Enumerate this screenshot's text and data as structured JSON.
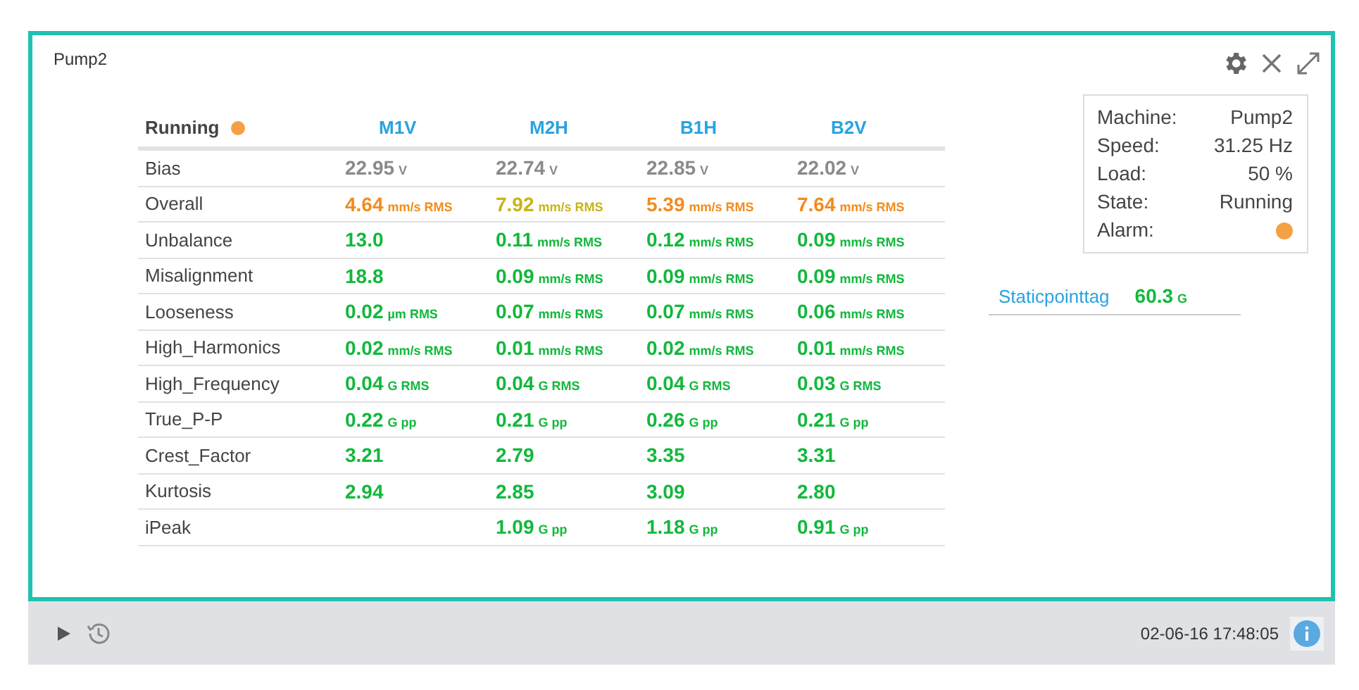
{
  "panel": {
    "title": "Pump2"
  },
  "table": {
    "state": {
      "label": "Running",
      "color": "#f5a045"
    },
    "columns": [
      "M1V",
      "M2H",
      "B1H",
      "B2V"
    ],
    "rows": [
      {
        "label": "Bias",
        "cells": [
          {
            "value": "22.95",
            "unit": "V",
            "color": "#8a8a8a"
          },
          {
            "value": "22.74",
            "unit": "V",
            "color": "#8a8a8a"
          },
          {
            "value": "22.85",
            "unit": "V",
            "color": "#8a8a8a"
          },
          {
            "value": "22.02",
            "unit": "V",
            "color": "#8a8a8a"
          }
        ]
      },
      {
        "label": "Overall",
        "cells": [
          {
            "value": "4.64",
            "unit": "mm/s RMS",
            "color": "#f28c1e"
          },
          {
            "value": "7.92",
            "unit": "mm/s RMS",
            "color": "#c9b418"
          },
          {
            "value": "5.39",
            "unit": "mm/s RMS",
            "color": "#f28c1e"
          },
          {
            "value": "7.64",
            "unit": "mm/s RMS",
            "color": "#f28c1e"
          }
        ]
      },
      {
        "label": "Unbalance",
        "cells": [
          {
            "value": "13.0",
            "color": "#12b83c"
          },
          {
            "value": "0.11",
            "unit": "mm/s RMS",
            "color": "#12b83c"
          },
          {
            "value": "0.12",
            "unit": "mm/s RMS",
            "color": "#12b83c"
          },
          {
            "value": "0.09",
            "unit": "mm/s RMS",
            "color": "#12b83c"
          }
        ]
      },
      {
        "label": "Misalignment",
        "cells": [
          {
            "value": "18.8",
            "color": "#12b83c"
          },
          {
            "value": "0.09",
            "unit": "mm/s RMS",
            "color": "#12b83c"
          },
          {
            "value": "0.09",
            "unit": "mm/s RMS",
            "color": "#12b83c"
          },
          {
            "value": "0.09",
            "unit": "mm/s RMS",
            "color": "#12b83c"
          }
        ]
      },
      {
        "label": "Looseness",
        "cells": [
          {
            "value": "0.02",
            "unit": "µm RMS",
            "color": "#12b83c"
          },
          {
            "value": "0.07",
            "unit": "mm/s RMS",
            "color": "#12b83c"
          },
          {
            "value": "0.07",
            "unit": "mm/s RMS",
            "color": "#12b83c"
          },
          {
            "value": "0.06",
            "unit": "mm/s RMS",
            "color": "#12b83c"
          }
        ]
      },
      {
        "label": "High_Harmonics",
        "cells": [
          {
            "value": "0.02",
            "unit": "mm/s RMS",
            "color": "#12b83c"
          },
          {
            "value": "0.01",
            "unit": "mm/s RMS",
            "color": "#12b83c"
          },
          {
            "value": "0.02",
            "unit": "mm/s RMS",
            "color": "#12b83c"
          },
          {
            "value": "0.01",
            "unit": "mm/s RMS",
            "color": "#12b83c"
          }
        ]
      },
      {
        "label": "High_Frequency",
        "cells": [
          {
            "value": "0.04",
            "unit": "G RMS",
            "color": "#12b83c"
          },
          {
            "value": "0.04",
            "unit": "G RMS",
            "color": "#12b83c"
          },
          {
            "value": "0.04",
            "unit": "G RMS",
            "color": "#12b83c"
          },
          {
            "value": "0.03",
            "unit": "G RMS",
            "color": "#12b83c"
          }
        ]
      },
      {
        "label": "True_P-P",
        "cells": [
          {
            "value": "0.22",
            "unit": "G pp",
            "color": "#12b83c"
          },
          {
            "value": "0.21",
            "unit": "G pp",
            "color": "#12b83c"
          },
          {
            "value": "0.26",
            "unit": "G pp",
            "color": "#12b83c"
          },
          {
            "value": "0.21",
            "unit": "G pp",
            "color": "#12b83c"
          }
        ]
      },
      {
        "label": "Crest_Factor",
        "cells": [
          {
            "value": "3.21",
            "color": "#12b83c"
          },
          {
            "value": "2.79",
            "color": "#12b83c"
          },
          {
            "value": "3.35",
            "color": "#12b83c"
          },
          {
            "value": "3.31",
            "color": "#12b83c"
          }
        ]
      },
      {
        "label": "Kurtosis",
        "cells": [
          {
            "value": "2.94",
            "color": "#12b83c"
          },
          {
            "value": "2.85",
            "color": "#12b83c"
          },
          {
            "value": "3.09",
            "color": "#12b83c"
          },
          {
            "value": "2.80",
            "color": "#12b83c"
          }
        ]
      },
      {
        "label": "iPeak",
        "cells": [
          null,
          {
            "value": "1.09",
            "unit": "G pp",
            "color": "#12b83c"
          },
          {
            "value": "1.18",
            "unit": "G pp",
            "color": "#12b83c"
          },
          {
            "value": "0.91",
            "unit": "G pp",
            "color": "#12b83c"
          }
        ]
      }
    ]
  },
  "info": [
    {
      "label": "Machine:",
      "value": "Pump2"
    },
    {
      "label": "Speed:",
      "value": "31.25 Hz"
    },
    {
      "label": "Load:",
      "value": "50 %"
    },
    {
      "label": "State:",
      "value": "Running"
    },
    {
      "label": "Alarm:",
      "color": "#f5a045"
    }
  ],
  "static_point": {
    "label": "Staticpointtag",
    "value": "60.3",
    "unit": "G",
    "color": "#12b83c"
  },
  "footer": {
    "timestamp": "02-06-16 17:48:05"
  }
}
